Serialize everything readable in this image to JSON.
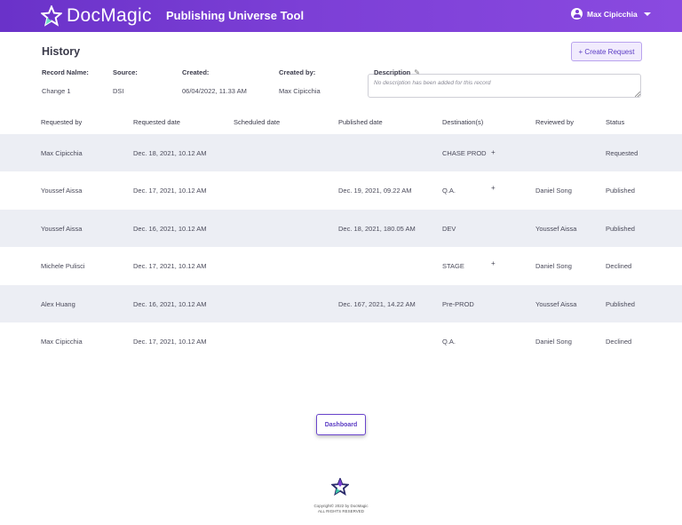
{
  "header": {
    "brand": "DocMagic",
    "app_title": "Publishing Universe Tool",
    "user_name": "Max Cipicchia",
    "brand_colors": {
      "gradient_start": "#6a32c9",
      "gradient_end": "#8a4ae0"
    }
  },
  "page": {
    "title": "History",
    "create_label": "+ Create Request"
  },
  "record": {
    "name_label": "Record Nalme:",
    "name_value": "Change 1",
    "source_label": "Source:",
    "source_value": "DSI",
    "created_label": "Created:",
    "created_value": "06/04/2022, 11.33 AM",
    "created_by_label": "Created by:",
    "created_by_value": "Max Cipicchia",
    "description_label": "Description",
    "description_placeholder": "No description has been added for this record"
  },
  "table": {
    "headers": {
      "requested_by": "Requested by",
      "requested_date": "Requested date",
      "scheduled_date": "Scheduled date",
      "published_date": "Published date",
      "destinations": "Destination(s)",
      "reviewed_by": "Reviewed by",
      "status": "Status"
    },
    "rows": [
      {
        "requested_by": "Max Cipicchia",
        "requested_date": "Dec. 18, 2021, 10.12 AM",
        "scheduled_date": "",
        "published_date": "",
        "destination": "CHASE PROD",
        "has_more": true,
        "reviewed_by": "",
        "status": "Requested"
      },
      {
        "requested_by": "Youssef Aissa",
        "requested_date": "Dec. 17, 2021, 10.12 AM",
        "scheduled_date": "",
        "published_date": "Dec. 19, 2021, 09.22 AM",
        "destination": "Q.A.",
        "has_more": true,
        "reviewed_by": "Daniel Song",
        "status": "Published"
      },
      {
        "requested_by": "Youssef Aissa",
        "requested_date": "Dec. 16, 2021, 10.12 AM",
        "scheduled_date": "",
        "published_date": "Dec. 18, 2021, 180.05 AM",
        "destination": "DEV",
        "has_more": false,
        "reviewed_by": "Youssef Aissa",
        "status": "Published"
      },
      {
        "requested_by": "Michele Pulisci",
        "requested_date": "Dec. 17, 2021, 10.12 AM",
        "scheduled_date": "",
        "published_date": "",
        "destination": "STAGE",
        "has_more": true,
        "reviewed_by": "Daniel Song",
        "status": "Declined"
      },
      {
        "requested_by": "Alex Huang",
        "requested_date": "Dec. 16, 2021, 10.12 AM",
        "scheduled_date": "",
        "published_date": "Dec. 167, 2021, 14.22 AM",
        "destination": "Pre-PROD",
        "has_more": false,
        "reviewed_by": "Youssef Aissa",
        "status": "Published"
      },
      {
        "requested_by": "Max Cipicchia",
        "requested_date": "Dec. 17, 2021, 10.12 AM",
        "scheduled_date": "",
        "published_date": "",
        "destination": "Q.A.",
        "has_more": false,
        "reviewed_by": "Daniel Song",
        "status": "Declined"
      }
    ],
    "more_symbol": "+"
  },
  "footer": {
    "dashboard_label": "Dashboard",
    "copyright_line1": "Copyright© 2022 by DocMagic",
    "copyright_line2": "ALL RIGHTS RESERVED"
  }
}
